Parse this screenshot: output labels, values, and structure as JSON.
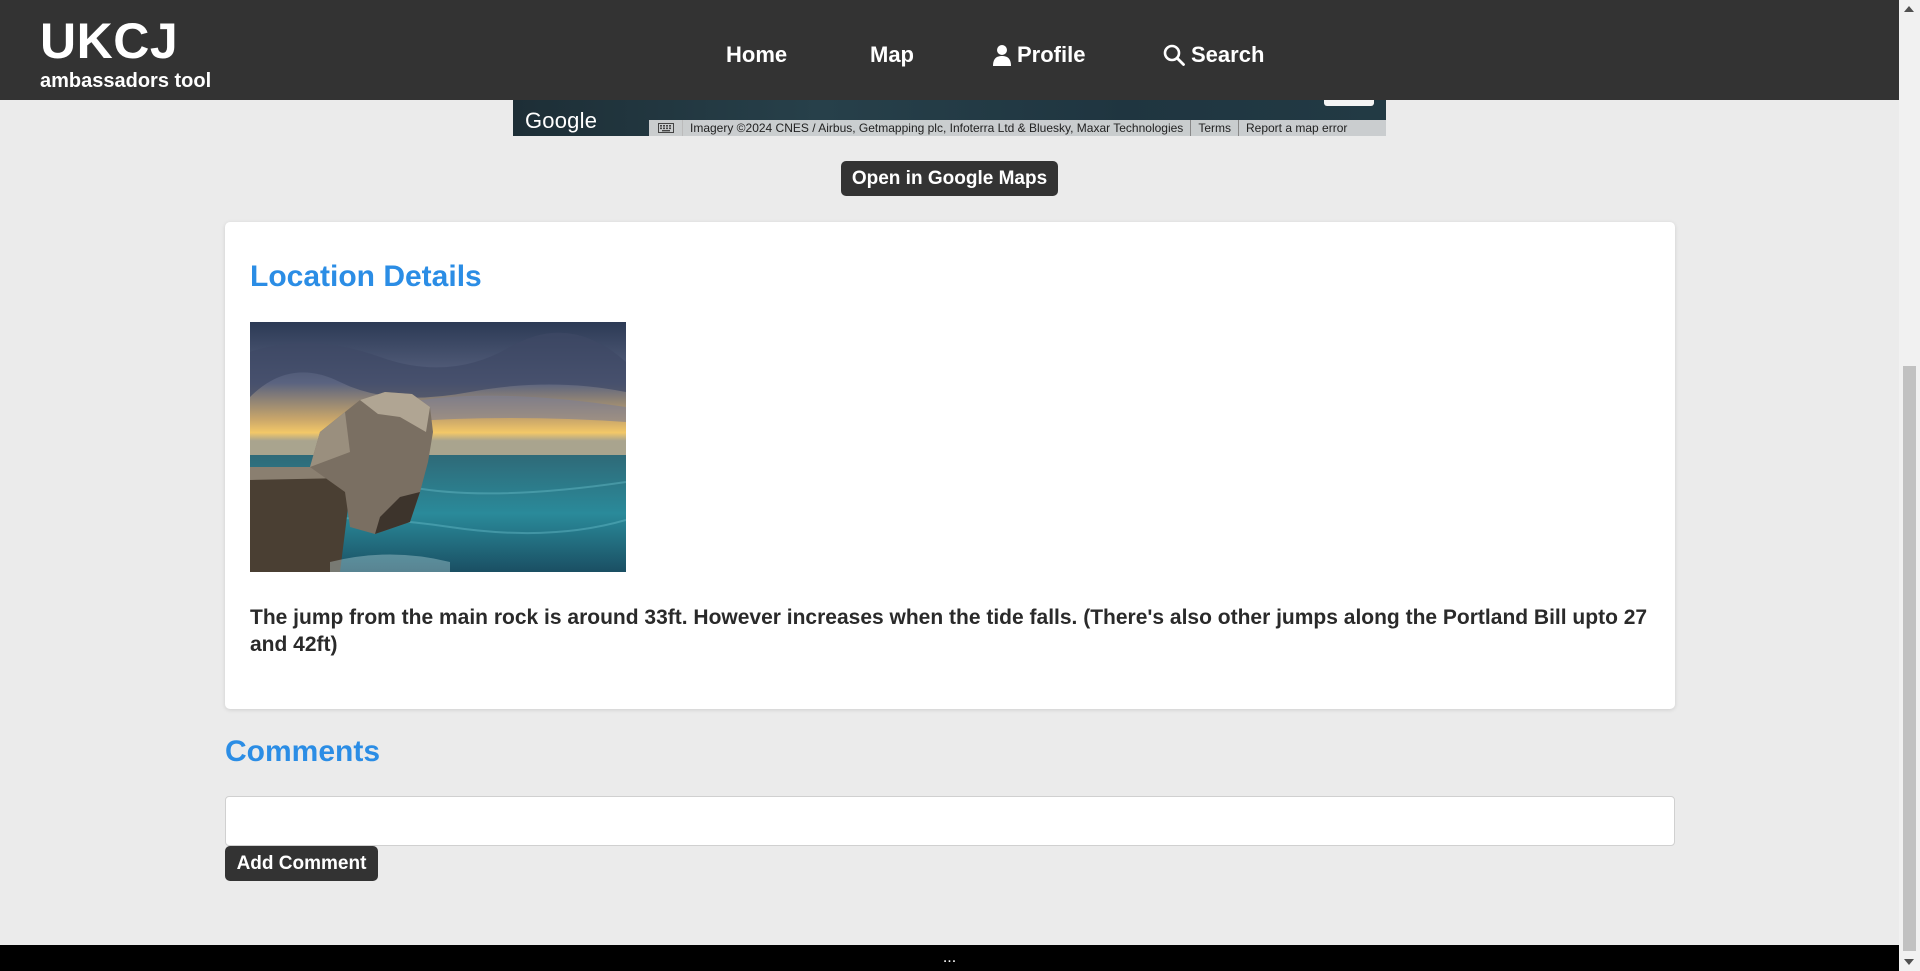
{
  "header": {
    "brand_title": "UKCJ",
    "brand_subtitle": "ambassadors tool",
    "nav": [
      {
        "label": "Home",
        "icon": null
      },
      {
        "label": "Map",
        "icon": null
      },
      {
        "label": "Profile",
        "icon": "person-icon"
      },
      {
        "label": "Search",
        "icon": "search-icon"
      }
    ]
  },
  "map": {
    "logo": "Google",
    "attribution": "Imagery ©2024 CNES / Airbus, Getmapping plc, Infoterra Ltd & Bluesky, Maxar Technologies",
    "terms_label": "Terms",
    "report_label": "Report a map error",
    "open_button_label": "Open in Google Maps"
  },
  "details": {
    "title": "Location Details",
    "photo_alt": "Sea stack at sunset",
    "description": "The jump from the main rock is around 33ft. However increases when the tide falls. (There's also other jumps along the Portland Bill upto 27 and 42ft)"
  },
  "comments": {
    "title": "Comments",
    "input_value": "",
    "input_placeholder": "",
    "add_button_label": "Add Comment"
  },
  "footer": {
    "text": "..."
  },
  "colors": {
    "header_bg": "#333333",
    "accent": "#2b8de5",
    "page_bg": "#ebebeb"
  }
}
